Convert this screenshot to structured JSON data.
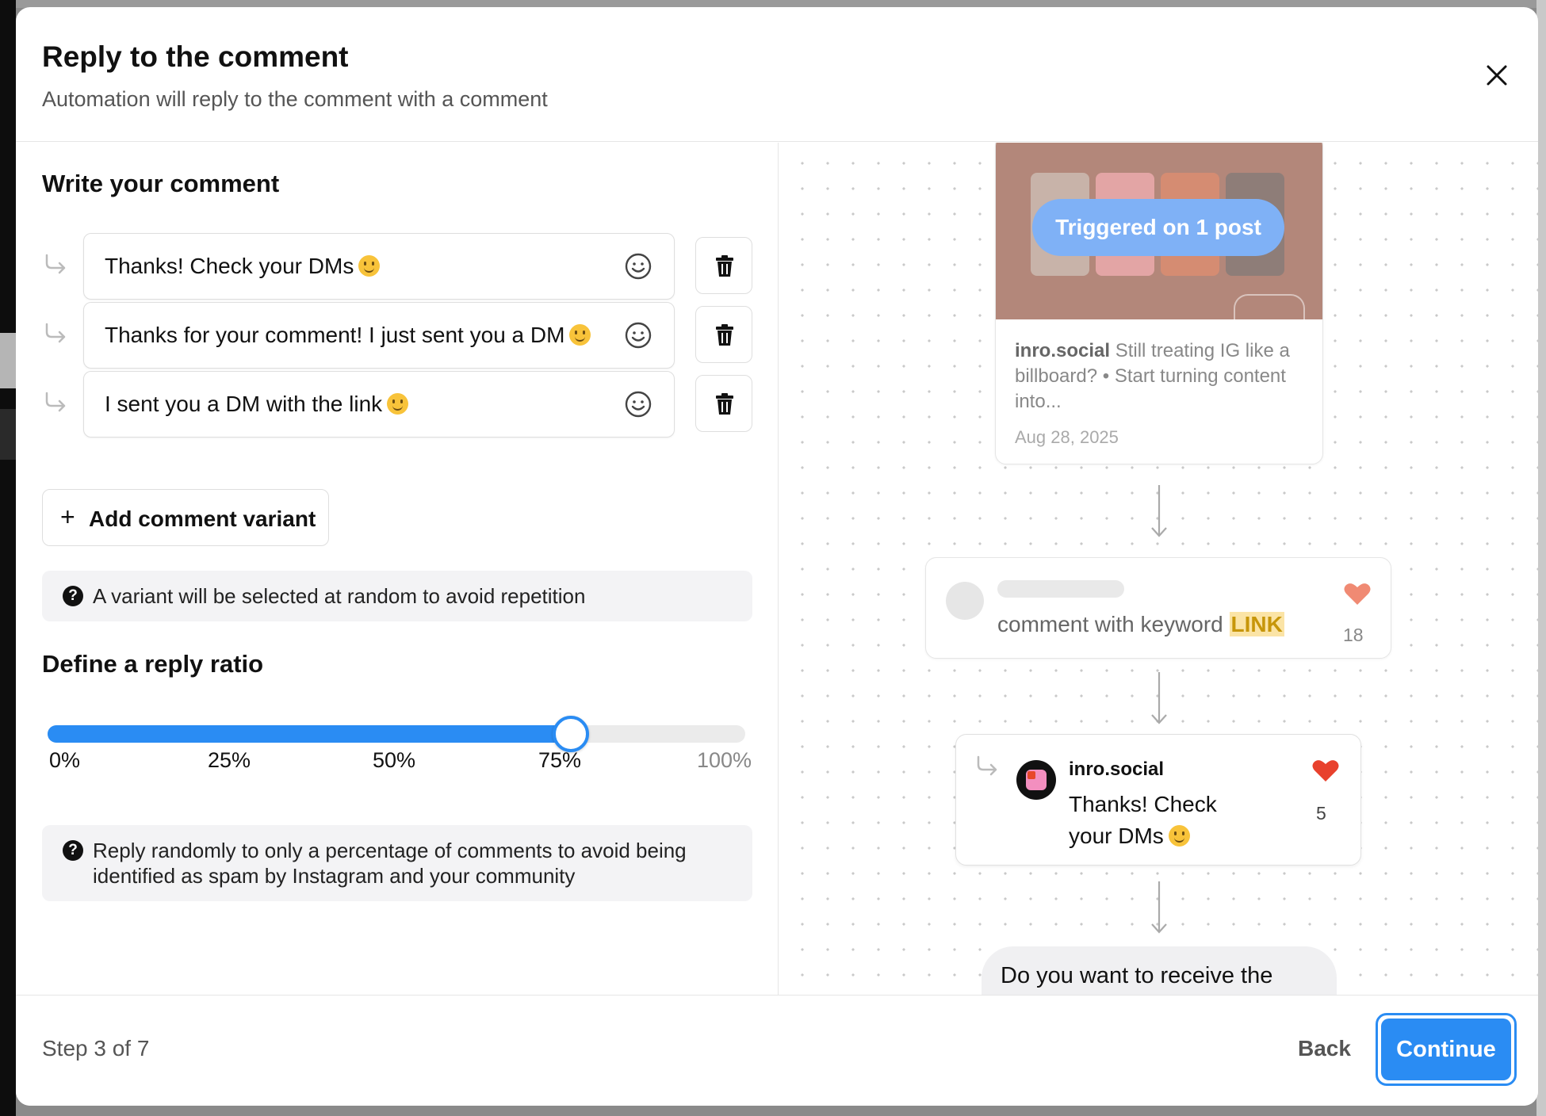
{
  "modal": {
    "title": "Reply to the comment",
    "subtitle": "Automation will reply to the comment with a comment"
  },
  "comment_section": {
    "title": "Write your comment",
    "variants": [
      {
        "text": "Thanks! Check your DMs"
      },
      {
        "text": "Thanks for your comment! I just sent you a DM"
      },
      {
        "text": "I sent you a DM with the link"
      }
    ],
    "add_variant_label": "Add comment variant",
    "note": "A variant will be selected at random to avoid repetition"
  },
  "ratio_section": {
    "title": "Define a reply ratio",
    "value_percent": 75,
    "ticks": [
      "0%",
      "25%",
      "50%",
      "75%",
      "100%"
    ],
    "note": "Reply randomly to only a percentage of comments to avoid being identified as spam by Instagram and your community"
  },
  "preview": {
    "post": {
      "badge": "Triggered on 1 post",
      "account": "inro.social",
      "caption": "Still treating IG like a billboard? • Start turning content into...",
      "date": "Aug 28, 2025"
    },
    "comment": {
      "text": "comment with keyword",
      "keyword": "LINK",
      "likes": "18"
    },
    "reply": {
      "account": "inro.social",
      "text": "Thanks! Check your DMs",
      "likes": "5"
    },
    "dm": {
      "text": "Do you want to receive the"
    }
  },
  "footer": {
    "step": "Step 3 of 7",
    "back_label": "Back",
    "continue_label": "Continue"
  },
  "colors": {
    "accent": "#2a8cf3",
    "heart_light": "#f08a73",
    "heart": "#e8412d",
    "keyword_bg": "#fbe4a6"
  }
}
